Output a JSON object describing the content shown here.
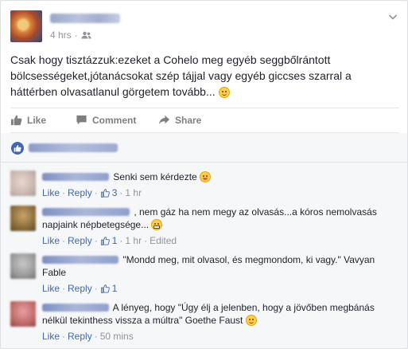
{
  "post": {
    "time": "4 hrs",
    "separator": "·",
    "text": "Csak hogy tisztázzuk:ezeket a Cohelo meg egyéb seggbőlrántott bölcsességeket,jótanácsokat szép tájjal vagy egyéb giccses szarral a háttérben olvasatlanul görgetem tovább...",
    "emoji": "smile"
  },
  "actions": {
    "like_label": "Like",
    "comment_label": "Comment",
    "share_label": "Share"
  },
  "comments": [
    {
      "text": "Senki sem kérdezte",
      "emoji": "tongue",
      "like": "Like",
      "reply": "Reply",
      "likes": "3",
      "time": "1 hr",
      "edited": "",
      "avatar_color": "#c9b8b0"
    },
    {
      "text": ", nem gáz ha nem megy az olvasás...a kóros nemolvasás napjaink népbetegsége...",
      "emoji": "grin",
      "like": "Like",
      "reply": "Reply",
      "likes": "1",
      "time": "1 hr",
      "edited": "Edited",
      "avatar_color": "#8a6d3b"
    },
    {
      "text": "\"Mondd meg, mit olvasol, és megmondom, ki vagy.\" Vavyan Fable",
      "emoji": "",
      "like": "Like",
      "reply": "Reply",
      "likes": "1",
      "time": "",
      "edited": "",
      "avatar_color": "#9b9b9b"
    },
    {
      "text": "A lényeg, hogy \"Úgy élj a jelenben, hogy a jövőben megbánás nélkül tekinthess vissza a múltra\" Goethe Faust",
      "emoji": "smile",
      "like": "Like",
      "reply": "Reply",
      "likes": "",
      "time": "50 mins",
      "edited": "",
      "avatar_color": "#c26a6a"
    }
  ]
}
